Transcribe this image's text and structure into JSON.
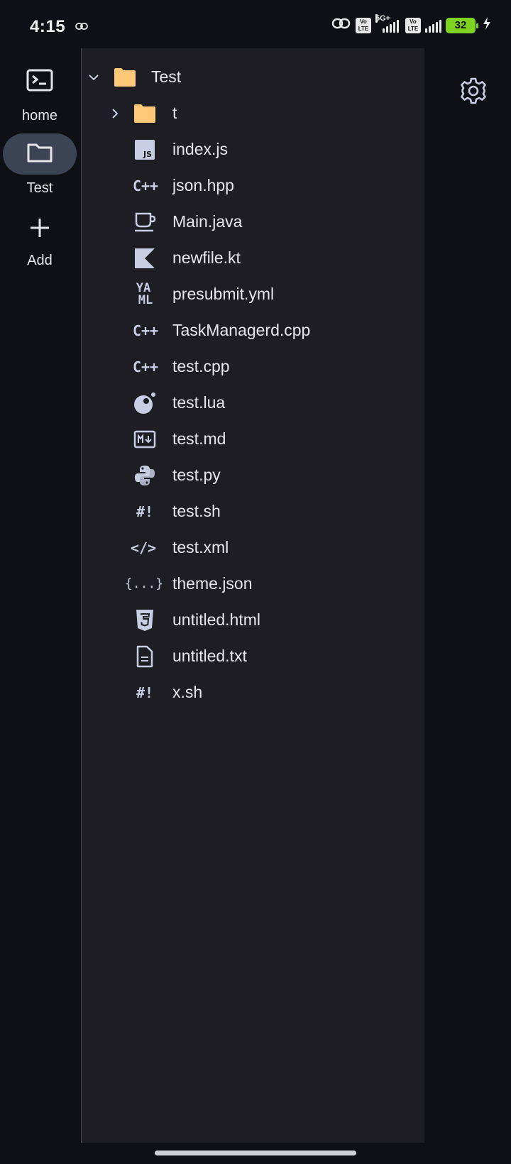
{
  "status_bar": {
    "time": "4:15",
    "volte_1": "Vo\nLTE",
    "network_type": "5G+",
    "volte_2": "Vo\nLTE",
    "battery_level": "32",
    "charging_icon": "bolt-icon"
  },
  "nav_rail": {
    "items": [
      {
        "label": "home",
        "icon": "terminal-icon",
        "active": false
      },
      {
        "label": "Test",
        "icon": "folder-icon",
        "active": true
      },
      {
        "label": "Add",
        "icon": "plus-icon",
        "active": false
      }
    ]
  },
  "file_tree": {
    "root": {
      "name": "Test",
      "expanded": true,
      "icon": "folder-icon"
    },
    "children": [
      {
        "name": "t",
        "type": "folder",
        "expanded": false,
        "icon": "folder-icon"
      },
      {
        "name": "index.js",
        "type": "file",
        "icon": "js-icon"
      },
      {
        "name": "json.hpp",
        "type": "file",
        "icon": "cpp-icon"
      },
      {
        "name": "Main.java",
        "type": "file",
        "icon": "java-icon"
      },
      {
        "name": "newfile.kt",
        "type": "file",
        "icon": "kotlin-icon"
      },
      {
        "name": "presubmit.yml",
        "type": "file",
        "icon": "yaml-icon"
      },
      {
        "name": "TaskManagerd.cpp",
        "type": "file",
        "icon": "cpp-icon"
      },
      {
        "name": "test.cpp",
        "type": "file",
        "icon": "cpp-icon"
      },
      {
        "name": "test.lua",
        "type": "file",
        "icon": "lua-icon"
      },
      {
        "name": "test.md",
        "type": "file",
        "icon": "markdown-icon"
      },
      {
        "name": "test.py",
        "type": "file",
        "icon": "python-icon"
      },
      {
        "name": "test.sh",
        "type": "file",
        "icon": "shell-icon"
      },
      {
        "name": "test.xml",
        "type": "file",
        "icon": "xml-icon"
      },
      {
        "name": "theme.json",
        "type": "file",
        "icon": "json-icon"
      },
      {
        "name": "untitled.html",
        "type": "file",
        "icon": "html-icon"
      },
      {
        "name": "untitled.txt",
        "type": "file",
        "icon": "text-file-icon"
      },
      {
        "name": "x.sh",
        "type": "file",
        "icon": "shell-icon"
      }
    ]
  },
  "icon_text": {
    "js": "JS",
    "cpp": "C++",
    "yaml_top": "YA",
    "yaml_bottom": "ML",
    "shell": "#!",
    "xml": "</>",
    "json": "{...}"
  },
  "colors": {
    "folder": "#ffc879",
    "icon": "#c9cde4",
    "panel_bg": "#1e1d23",
    "background": "#0f1015",
    "active_pill": "#3b4354",
    "battery": "#7ed321"
  }
}
